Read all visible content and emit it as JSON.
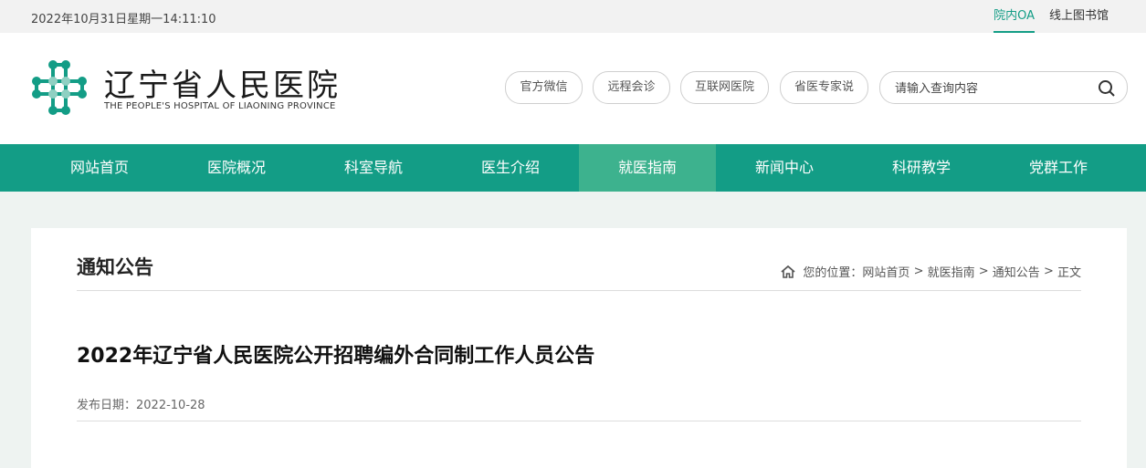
{
  "topbar": {
    "datetime": "2022年10月31日星期一14:11:10",
    "link_oa": "院内OA",
    "link_library": "线上图书馆"
  },
  "header": {
    "brand_cn": "辽宁省人民医院",
    "brand_en": "THE PEOPLE'S HOSPITAL OF LIAONING PROVINCE",
    "pills": [
      "官方微信",
      "远程会诊",
      "互联网医院",
      "省医专家说"
    ],
    "search_placeholder": "请输入查询内容"
  },
  "nav": {
    "items": [
      "网站首页",
      "医院概况",
      "科室导航",
      "医生介绍",
      "就医指南",
      "新闻中心",
      "科研教学",
      "党群工作"
    ],
    "active": "就医指南"
  },
  "content": {
    "section_title": "通知公告",
    "breadcrumb": {
      "prefix": "您的位置：",
      "items": [
        "网站首页",
        "就医指南",
        "通知公告",
        "正文"
      ],
      "separator": " > "
    },
    "article_title": "2022年辽宁省人民医院公开招聘编外合同制工作人员公告",
    "publish_date": "发布日期：2022-10-28"
  },
  "colors": {
    "brand_green": "#139d86",
    "nav_active": "#3db28e",
    "page_bg": "#eef3f1"
  },
  "icons": [
    "hospital-logo-icon",
    "search-icon",
    "home-icon"
  ]
}
